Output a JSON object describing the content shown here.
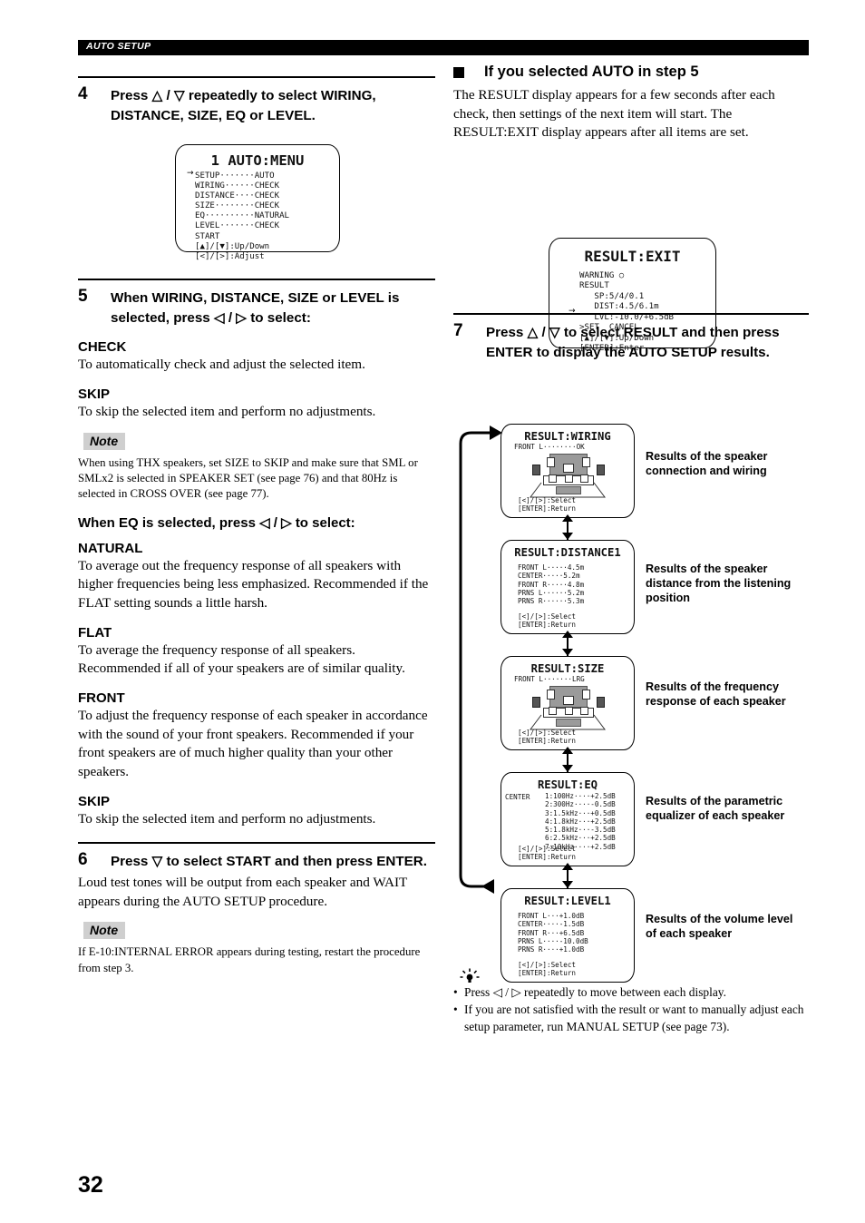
{
  "header": {
    "running_title": "AUTO SETUP"
  },
  "page_number": "32",
  "left_column": {
    "step4": {
      "number": "4",
      "heading": "Press △ / ▽ repeatedly to select WIRING, DISTANCE, SIZE, EQ or LEVEL.",
      "osd": {
        "title": "1 AUTO:MENU",
        "cursor": "→",
        "lines": "SETUP·······AUTO\nWIRING······CHECK\nDISTANCE····CHECK\nSIZE········CHECK\nEQ··········NATURAL\nLEVEL·······CHECK\nSTART\n[▲]/[▼]:Up/Down\n[<]/[>]:Adjust"
      }
    },
    "step5": {
      "number": "5",
      "heading": "When WIRING, DISTANCE, SIZE or LEVEL is selected, press ◁ / ▷ to select:",
      "check_label": "CHECK",
      "check_text": "To automatically check and adjust the selected item.",
      "skip_label": "SKIP",
      "skip_text": "To skip the selected item and perform no adjustments.",
      "note_label": "Note",
      "note_text": "When using THX speakers, set SIZE to SKIP and make sure that SML or SMLx2 is selected in SPEAKER SET (see page 76) and that 80Hz is selected in CROSS OVER (see page 77).",
      "eq_heading": "When EQ is selected, press ◁ / ▷ to select:",
      "natural_label": "NATURAL",
      "natural_text": "To average out the frequency response of all speakers with higher frequencies being less emphasized. Recommended if the FLAT setting sounds a little harsh.",
      "flat_label": "FLAT",
      "flat_text": "To average the frequency response of all speakers. Recommended if all of your speakers are of similar quality.",
      "front_label": "FRONT",
      "front_text": "To adjust the frequency response of each speaker in accordance with the sound of your front speakers. Recommended if your front speakers are of much higher quality than your other speakers.",
      "skip2_label": "SKIP",
      "skip2_text": "To skip the selected item and perform no adjustments."
    },
    "step6": {
      "number": "6",
      "heading": "Press ▽ to select START and then press ENTER.",
      "text": "Loud test tones will be output from each speaker and WAIT appears during the AUTO SETUP procedure.",
      "note_label": "Note",
      "note_text": "If E-10:INTERNAL ERROR appears during testing, restart the procedure from step 3."
    }
  },
  "right_column": {
    "section": {
      "heading": "If you selected AUTO in step 5",
      "text": "The RESULT display appears for a few seconds after each check, then settings of the next item will start. The RESULT:EXIT display appears after all items are set."
    },
    "exit_osd": {
      "title": "RESULT:EXIT",
      "cursor": "→",
      "lines": "WARNING ○\nRESULT\n   SP:5/4/0.1\n   DIST:4.5/6.1m\n   LVL:-10.0/+6.5dB\n>SET  CANCEL\n[▲]/[▼]:Up/Down\n[ENTER]:Enter"
    },
    "step7": {
      "number": "7",
      "heading": "Press △ / ▽ to select RESULT and then press ENTER to display the AUTO SETUP results."
    },
    "results": [
      {
        "title": "RESULT:WIRING",
        "lines": "FRONT L········OK",
        "has_diagram": true,
        "footer": "[<]/[>]:Select\n[ENTER]:Return",
        "caption": "Results of the speaker connection and wiring"
      },
      {
        "title": "RESULT:DISTANCE1",
        "lines": "FRONT L·····4.5m\nCENTER·····5.2m\nFRONT R·····4.8m\nPRNS L······5.2m\nPRNS R······5.3m",
        "has_diagram": false,
        "footer": "[<]/[>]:Select\n[ENTER]:Return",
        "caption": "Results of the speaker distance from the listening position"
      },
      {
        "title": "RESULT:SIZE",
        "lines": "FRONT L·······LRG",
        "has_diagram": true,
        "footer": "[<]/[>]:Select\n[ENTER]:Return",
        "caption": "Results of the frequency response of each speaker"
      },
      {
        "title": "RESULT:EQ",
        "prefix": "CENTER",
        "lines": "1:100Hz····+2.5dB\n2:300Hz····-0.5dB\n3:1.5kHz···+0.5dB\n4:1.8kHz···+2.5dB\n5:1.8kHz···-3.5dB\n6:2.5kHz···+2.5dB\n7:10kHz····+2.5dB",
        "has_diagram": false,
        "footer": "[<]/[>]:Select\n[ENTER]:Return",
        "caption": "Results of the parametric equalizer of each speaker"
      },
      {
        "title": "RESULT:LEVEL1",
        "lines": "FRONT L···+1.0dB\nCENTER····-1.5dB\nFRONT R···+6.5dB\nPRNS L····-10.0dB\nPRNS R····+1.0dB",
        "has_diagram": false,
        "footer": "[<]/[>]:Select\n[ENTER]:Return",
        "caption": "Results of the volume level of each speaker"
      }
    ],
    "tips": [
      "Press ◁ / ▷ repeatedly to move between each display.",
      "If you are not satisfied with the result or want to manually adjust each setup parameter, run MANUAL SETUP (see page 73)."
    ]
  }
}
